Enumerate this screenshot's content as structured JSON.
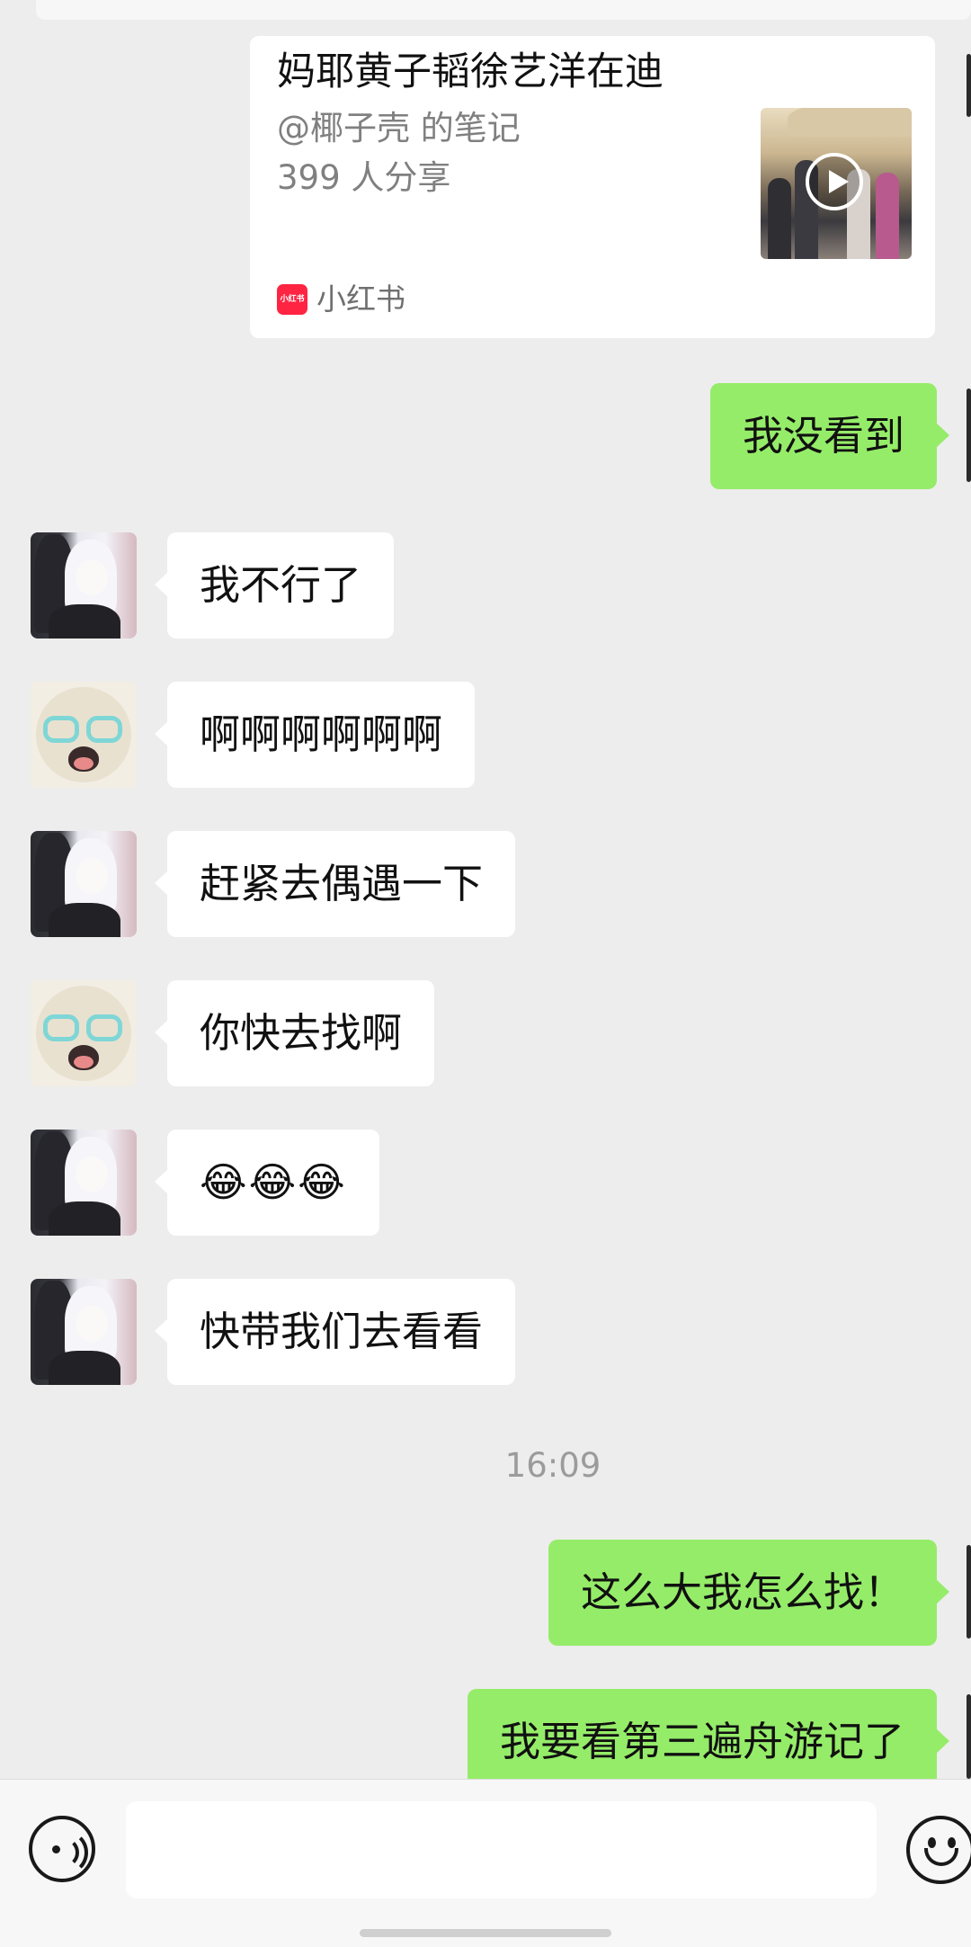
{
  "shared_card": {
    "title": "妈耶黄子韬徐艺洋在迪",
    "author": "@椰子壳 的笔记",
    "shares": "399 人分享",
    "app_badge": "小红书",
    "app_name": "小红书"
  },
  "messages": [
    {
      "side": "out",
      "text": "我没看到"
    },
    {
      "side": "in",
      "avatar": "girl",
      "text": "我不行了"
    },
    {
      "side": "in",
      "avatar": "bear",
      "text": "啊啊啊啊啊啊"
    },
    {
      "side": "in",
      "avatar": "girl",
      "text": "赶紧去偶遇一下"
    },
    {
      "side": "in",
      "avatar": "bear",
      "text": "你快去找啊"
    },
    {
      "side": "in",
      "avatar": "girl",
      "text": "😂😂😂"
    },
    {
      "side": "in",
      "avatar": "girl",
      "text": "快带我们去看看"
    },
    {
      "side": "out",
      "text": "这么大我怎么找！"
    },
    {
      "side": "out",
      "text": "我要看第三遍舟游记了"
    }
  ],
  "timestamp": "16:09",
  "input_bar": {
    "voice_icon": "voice-icon",
    "emoji_icon": "emoji-icon",
    "input_value": ""
  },
  "colors": {
    "background": "#ededed",
    "outgoing_bubble": "#95ec69",
    "incoming_bubble": "#ffffff",
    "app_badge": "#ff2442"
  }
}
